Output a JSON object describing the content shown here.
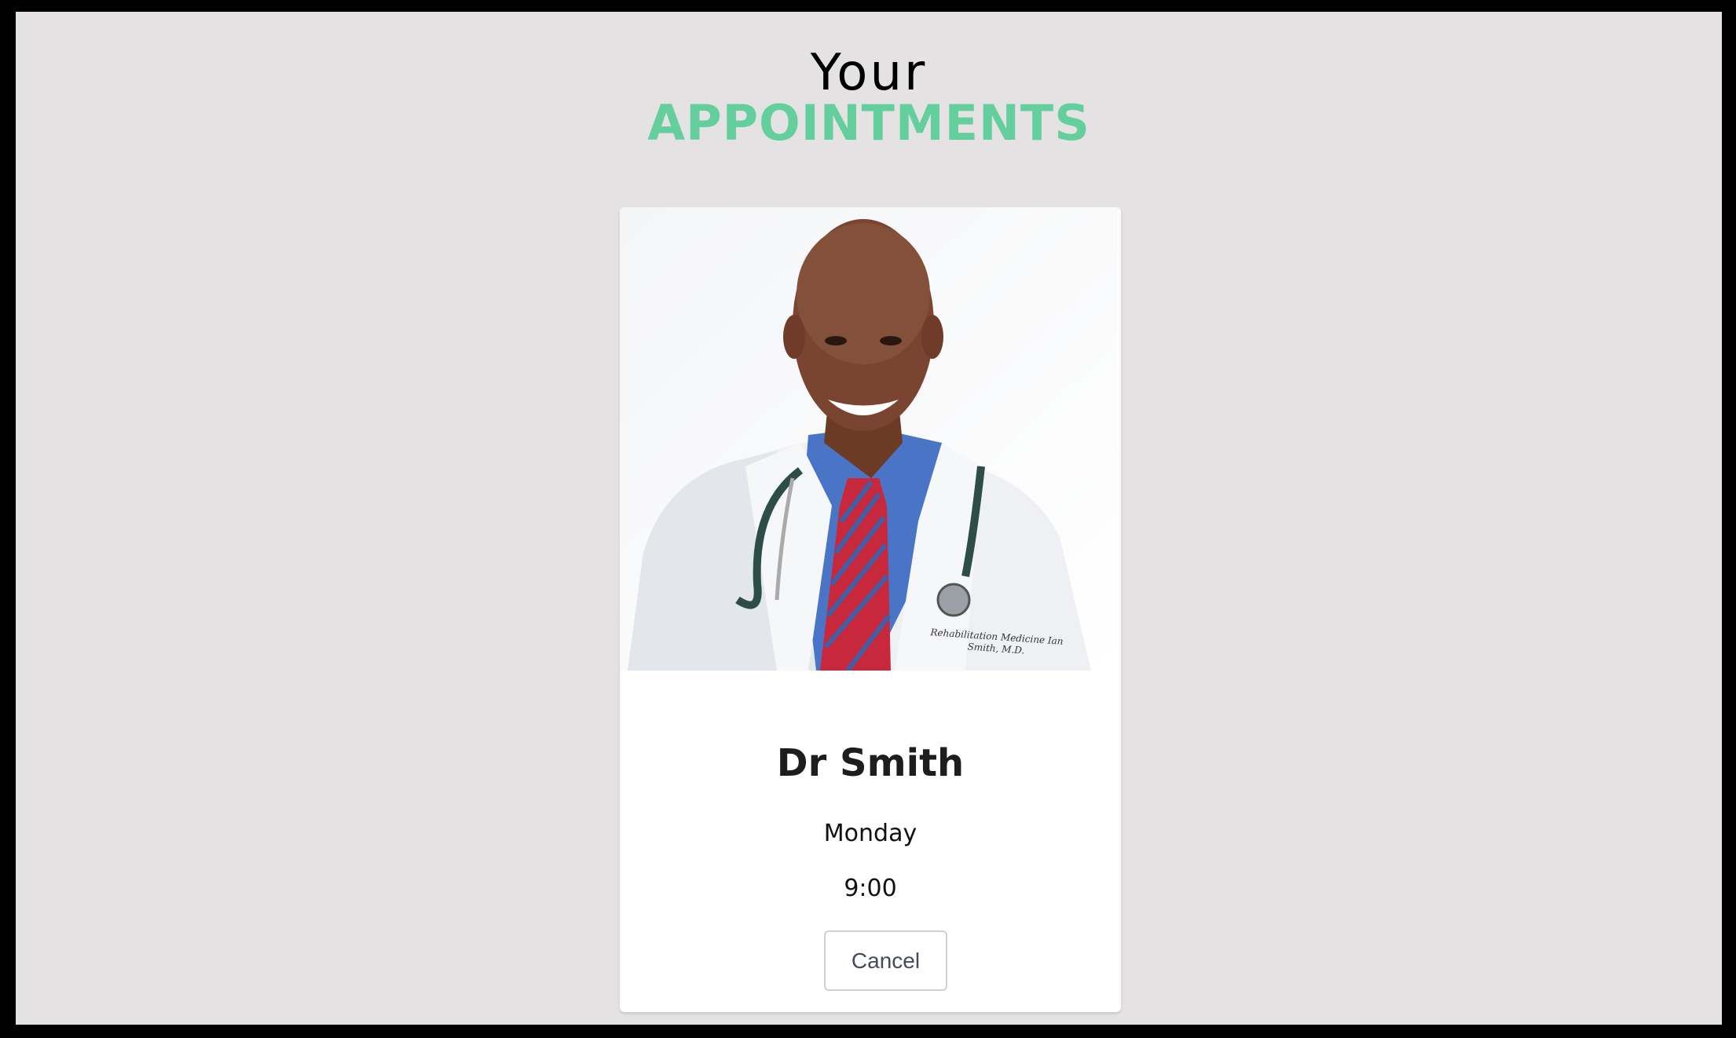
{
  "header": {
    "title_line1": "Your",
    "title_line2": "APPOINTMENTS"
  },
  "colors": {
    "accent": "#64cf9d",
    "background": "#e4e2e3",
    "frame": "#000000"
  },
  "appointment": {
    "doctor_name": "Dr Smith",
    "day": "Monday",
    "time": "9:00",
    "photo_alt": "doctor-photo",
    "coat_embroidery": "Rehabilitation Medicine Ian Smith, M.D.",
    "cancel_label": "Cancel"
  }
}
